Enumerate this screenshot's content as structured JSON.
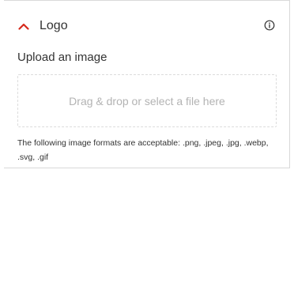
{
  "section": {
    "title": "Logo",
    "chevron_icon": "chevron-up-icon",
    "info_icon": "info-icon",
    "accent_color": "#d6291c"
  },
  "upload": {
    "label": "Upload an image",
    "dropzone_text": "Drag & drop or select a file here",
    "formats_note": "The following image formats are acceptable: .png, .jpeg, .jpg, .webp, .svg, .gif"
  }
}
